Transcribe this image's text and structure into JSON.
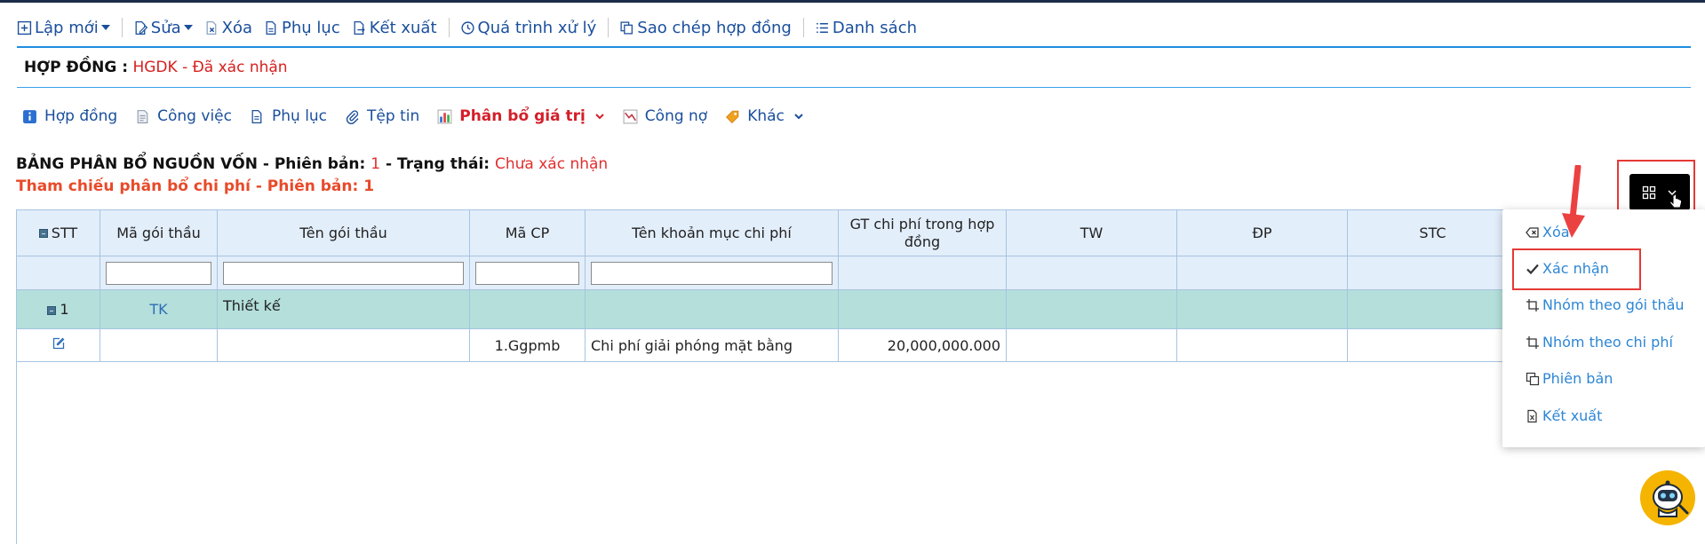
{
  "toolbar": {
    "new_label": "Lập mới",
    "edit_label": "Sửa",
    "delete_label": "Xóa",
    "appendix_label": "Phụ lục",
    "export_label": "Kết xuất",
    "process_label": "Quá trình xử lý",
    "copy_contract_label": "Sao chép hợp đồng",
    "list_label": "Danh sách"
  },
  "contract": {
    "label": "HỢP ĐỒNG :",
    "value": "HGDK - Đã xác nhận"
  },
  "tabs": [
    {
      "label": "Hợp đồng"
    },
    {
      "label": "Công việc"
    },
    {
      "label": "Phụ lục"
    },
    {
      "label": "Tệp tin"
    },
    {
      "label": "Phân bổ giá trị",
      "active": true
    },
    {
      "label": "Công nợ"
    },
    {
      "label": "Khác"
    }
  ],
  "allocation": {
    "title_prefix": "BẢNG PHÂN BỔ NGUỒN VỐN - Phiên bản: ",
    "version": "1",
    "status_prefix": " - Trạng thái: ",
    "status": "Chưa xác nhận",
    "reference": "Tham chiếu phân bổ chi phí - Phiên bản: 1"
  },
  "table": {
    "columns": [
      "STT",
      "Mã gói thầu",
      "Tên gói thầu",
      "Mã CP",
      "Tên khoản mục chi phí",
      "GT chi phí trong hợp đồng",
      "TW",
      "ĐP",
      "STC"
    ],
    "group_row": {
      "stt": "1",
      "package_code": "TK",
      "package_name": "Thiết kế"
    },
    "data_row": {
      "cost_code": "1.Ggpmb",
      "cost_name": "Chi phí giải phóng mặt bằng",
      "amount": "20,000,000.000"
    }
  },
  "dropdown": {
    "items": [
      {
        "label": "Xóa",
        "icon": "backspace-icon"
      },
      {
        "label": "Xác nhận",
        "icon": "check-icon"
      },
      {
        "label": "Nhóm theo gói thầu",
        "icon": "crop-icon"
      },
      {
        "label": "Nhóm theo chi phí",
        "icon": "crop-icon"
      },
      {
        "label": "Phiên bản",
        "icon": "copy-icon"
      },
      {
        "label": "Kết xuất",
        "icon": "excel-icon"
      }
    ]
  },
  "colors": {
    "link_blue": "#1a4f9c",
    "accent_red": "#d41f2a",
    "group_row": "#b4dfdb",
    "header_bg": "#e3eefb",
    "dropdown_link": "#2d86d4"
  }
}
